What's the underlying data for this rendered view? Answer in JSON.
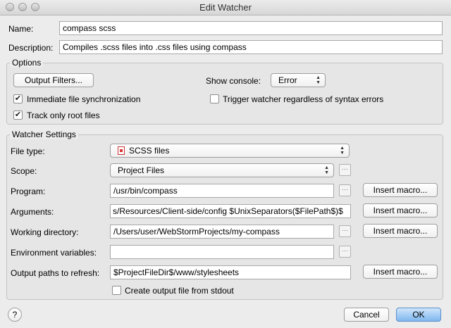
{
  "window": {
    "title": "Edit Watcher"
  },
  "name": {
    "label": "Name:",
    "value": "compass scss"
  },
  "description": {
    "label": "Description:",
    "value": "Compiles .scss files into .css files using compass"
  },
  "options": {
    "title": "Options",
    "output_filters_label": "Output Filters...",
    "show_console_label": "Show console:",
    "show_console_value": "Error",
    "immediate_sync_label": "Immediate file synchronization",
    "immediate_sync_checked": true,
    "trigger_label": "Trigger watcher regardless of syntax errors",
    "trigger_checked": false,
    "track_root_label": "Track only root files",
    "track_root_checked": true
  },
  "settings": {
    "title": "Watcher Settings",
    "file_type": {
      "label": "File type:",
      "value": "SCSS files"
    },
    "scope": {
      "label": "Scope:",
      "value": "Project Files"
    },
    "program": {
      "label": "Program:",
      "value": "/usr/bin/compass"
    },
    "arguments": {
      "label": "Arguments:",
      "value": "s/Resources/Client-side/config $UnixSeparators($FilePath$)$"
    },
    "working_dir": {
      "label": "Working directory:",
      "value": "/Users/user/WebStormProjects/my-compass"
    },
    "env_vars": {
      "label": "Environment variables:",
      "value": ""
    },
    "output_paths": {
      "label": "Output paths to refresh:",
      "value": "$ProjectFileDir$/www/stylesheets"
    },
    "insert_macro_label": "Insert macro...",
    "create_output_label": "Create output file from stdout",
    "create_output_checked": false
  },
  "footer": {
    "help_label": "?",
    "cancel_label": "Cancel",
    "ok_label": "OK"
  },
  "colors": {
    "ok_button": "#7fb7ef",
    "accent": "#5b8fc7",
    "file_icon": "#cc3333"
  }
}
